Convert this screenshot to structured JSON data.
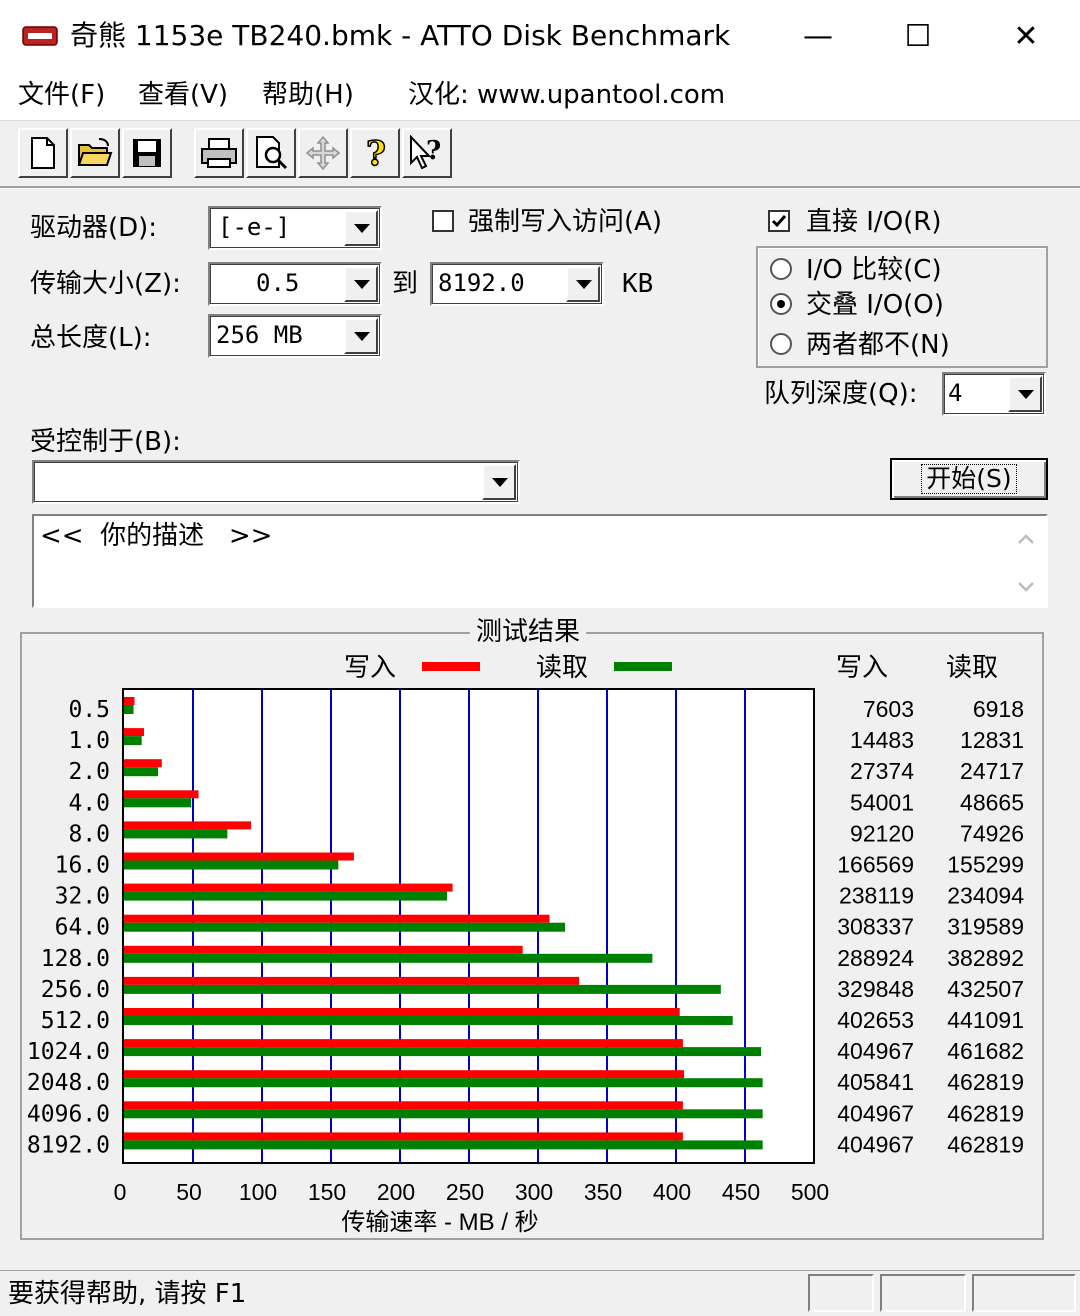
{
  "window": {
    "title": "奇熊 1153e TB240.bmk - ATTO Disk Benchmark",
    "icon": "atto-app-icon",
    "minimize_glyph": "—",
    "maximize_glyph": "☐",
    "close_glyph": "✕"
  },
  "menu": {
    "file": "文件(F)",
    "view": "查看(V)",
    "help": "帮助(H)",
    "localized": "汉化: www.upantool.com"
  },
  "toolbar": {
    "icons": [
      "new-file-icon",
      "open-folder-icon",
      "save-icon",
      "print-icon",
      "print-preview-icon",
      "move-icon",
      "help-icon",
      "context-help-icon"
    ]
  },
  "settings": {
    "drive_label": "驱动器(D):",
    "drive_value": "[-e-]",
    "transfer_label": "传输大小(Z):",
    "transfer_from": "0.5",
    "to_label": "到",
    "transfer_to": "8192.0",
    "kb_label": "KB",
    "length_label": "总长度(L):",
    "length_value": "256 MB",
    "force_write_label": "强制写入访问(A)",
    "force_write_checked": false,
    "direct_io_label": "直接 I/O(R)",
    "direct_io_checked": true,
    "io_compare_label": "I/O 比较(C)",
    "overlapped_io_label": "交叠 I/O(O)",
    "neither_label": "两者都不(N)",
    "selected_mode": "overlapped",
    "queue_label": "队列深度(Q):",
    "queue_value": "4",
    "controlled_by_label": "受控制于(B):",
    "controlled_by_value": "",
    "start_button": "开始(S)",
    "description": "<<  你的描述   >>"
  },
  "results": {
    "group_title": "测试结果",
    "legend_write": "写入",
    "legend_read": "读取",
    "col_write": "写入",
    "col_read": "读取",
    "xlabel": "传输速率 - MB / 秒"
  },
  "chart_data": {
    "type": "bar",
    "orientation": "horizontal",
    "categories": [
      "0.5",
      "1.0",
      "2.0",
      "4.0",
      "8.0",
      "16.0",
      "32.0",
      "64.0",
      "128.0",
      "256.0",
      "512.0",
      "1024.0",
      "2048.0",
      "4096.0",
      "8192.0"
    ],
    "series": [
      {
        "name": "写入",
        "color": "#ff0000",
        "values": [
          7.6,
          14.5,
          27.4,
          54.0,
          92.1,
          166.6,
          238.1,
          308.3,
          288.9,
          329.8,
          402.7,
          405.0,
          405.8,
          405.0,
          405.0
        ]
      },
      {
        "name": "读取",
        "color": "#008000",
        "values": [
          6.9,
          12.8,
          24.7,
          48.7,
          74.9,
          155.3,
          234.1,
          319.6,
          382.9,
          432.5,
          441.1,
          461.7,
          462.8,
          462.8,
          462.8
        ]
      }
    ],
    "write_kb": [
      "7603",
      "14483",
      "27374",
      "54001",
      "92120",
      "166569",
      "238119",
      "308337",
      "288924",
      "329848",
      "402653",
      "404967",
      "405841",
      "404967",
      "404967"
    ],
    "read_kb": [
      "6918",
      "12831",
      "24717",
      "48665",
      "74926",
      "155299",
      "234094",
      "319589",
      "382892",
      "432507",
      "441091",
      "461682",
      "462819",
      "462819",
      "462819"
    ],
    "xticks": [
      "0",
      "50",
      "100",
      "150",
      "200",
      "250",
      "300",
      "350",
      "400",
      "450",
      "500"
    ],
    "xlim": [
      0,
      500
    ],
    "grid_color": "#0000cc",
    "grid": true
  },
  "status": {
    "text": "要获得帮助, 请按 F1"
  }
}
